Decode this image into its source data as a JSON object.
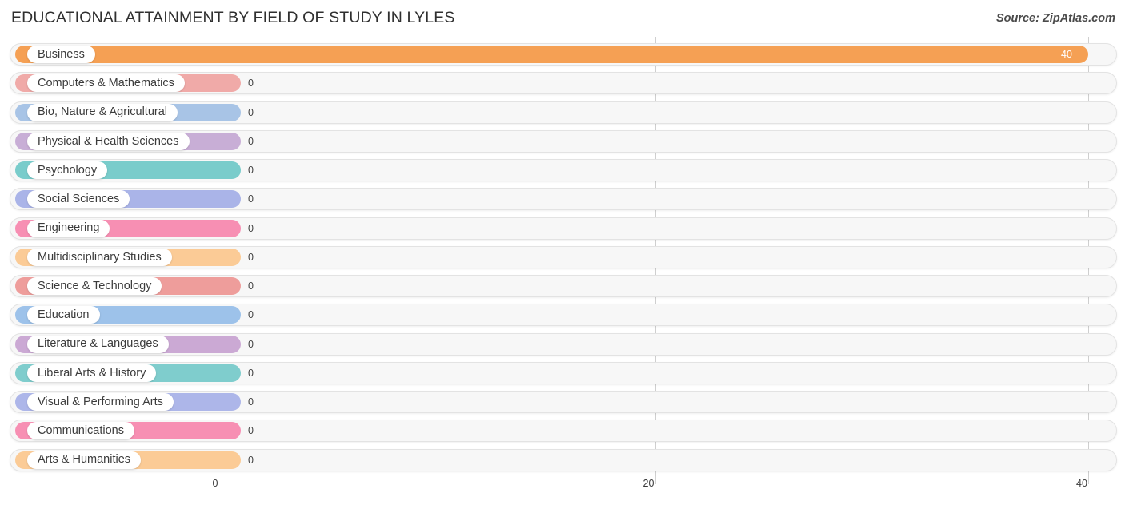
{
  "header": {
    "title": "EDUCATIONAL ATTAINMENT BY FIELD OF STUDY IN LYLES",
    "source": "Source: ZipAtlas.com"
  },
  "chart_data": {
    "type": "bar",
    "orientation": "horizontal",
    "title": "EDUCATIONAL ATTAINMENT BY FIELD OF STUDY IN LYLES",
    "xlabel": "",
    "ylabel": "",
    "xlim": [
      0,
      40
    ],
    "ticks": [
      "0",
      "20",
      "40"
    ],
    "tick_values": [
      0,
      20,
      40
    ],
    "grid": true,
    "legend": null,
    "categories": [
      "Business",
      "Computers & Mathematics",
      "Bio, Nature & Agricultural",
      "Physical & Health Sciences",
      "Psychology",
      "Social Sciences",
      "Engineering",
      "Multidisciplinary Studies",
      "Science & Technology",
      "Education",
      "Literature & Languages",
      "Liberal Arts & History",
      "Visual & Performing Arts",
      "Communications",
      "Arts & Humanities"
    ],
    "values": [
      40,
      0,
      0,
      0,
      0,
      0,
      0,
      0,
      0,
      0,
      0,
      0,
      0,
      0,
      0
    ],
    "value_labels": [
      "40",
      "0",
      "0",
      "0",
      "0",
      "0",
      "0",
      "0",
      "0",
      "0",
      "0",
      "0",
      "0",
      "0",
      "0"
    ],
    "colors": [
      "#f5a054",
      "#f0aaa8",
      "#a8c4e6",
      "#c8aed6",
      "#79cccb",
      "#aab4e8",
      "#f78fb3",
      "#fbcb96",
      "#ee9d9b",
      "#9dc2ea",
      "#cba9d4",
      "#7fcdcd",
      "#adb6e9",
      "#f78fb3",
      "#fbcb96"
    ]
  }
}
